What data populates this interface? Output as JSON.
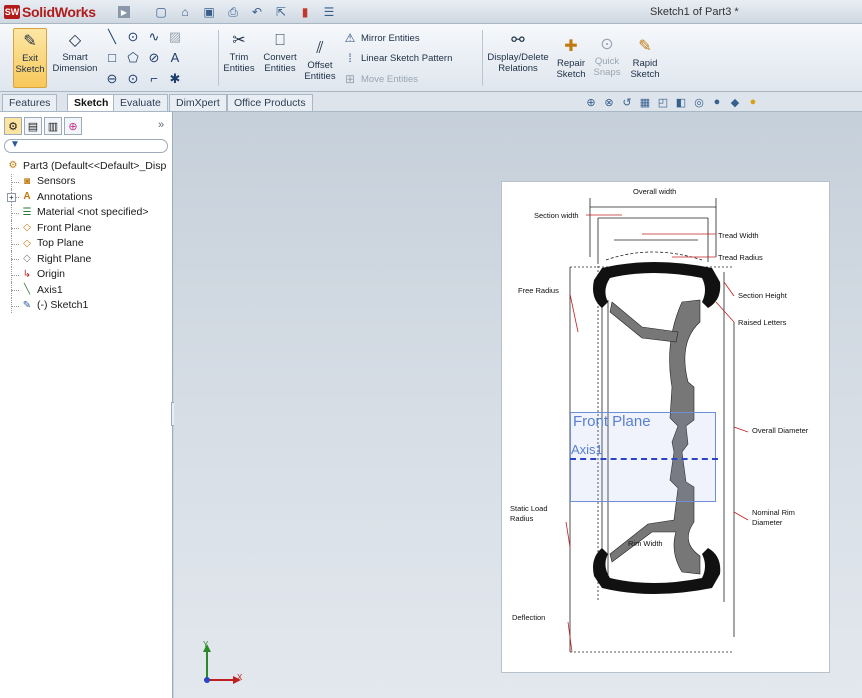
{
  "app": {
    "logo_mark": "SW",
    "name": "SolidWorks",
    "document_title": "Sketch1 of Part3 *"
  },
  "quick_access": [
    {
      "name": "new-icon",
      "glyph": "▢"
    },
    {
      "name": "open-icon",
      "glyph": "📂"
    },
    {
      "name": "save-icon",
      "glyph": "▣"
    },
    {
      "name": "print-icon",
      "glyph": "⎙"
    },
    {
      "name": "undo-icon",
      "glyph": "↶"
    },
    {
      "name": "select-icon",
      "glyph": "⇱"
    },
    {
      "name": "rebuild-icon",
      "glyph": "▮"
    },
    {
      "name": "options-icon",
      "glyph": "☰"
    }
  ],
  "ribbon": {
    "exit_sketch": {
      "line1": "Exit",
      "line2": "Sketch"
    },
    "smart_dimension": {
      "line1": "Smart",
      "line2": "Dimension"
    },
    "trim": {
      "line1": "Trim",
      "line2": "Entities"
    },
    "convert": {
      "line1": "Convert",
      "line2": "Entities"
    },
    "offset": {
      "line1": "Offset",
      "line2": "Entities"
    },
    "mirror": "Mirror Entities",
    "linear_pattern": "Linear Sketch Pattern",
    "move": "Move Entities",
    "display_delete": {
      "line1": "Display/Delete",
      "line2": "Relations"
    },
    "repair": {
      "line1": "Repair",
      "line2": "Sketch"
    },
    "quick_snaps": {
      "line1": "Quick",
      "line2": "Snaps"
    },
    "rapid": {
      "line1": "Rapid",
      "line2": "Sketch"
    }
  },
  "tabs": [
    "Features",
    "Sketch",
    "Evaluate",
    "DimXpert",
    "Office Products"
  ],
  "active_tab": "Sketch",
  "tree": {
    "root": "Part3  (Default<<Default>_Disp",
    "items": [
      {
        "label": "Sensors",
        "icon": "sensors-icon",
        "glyph": "◙"
      },
      {
        "label": "Annotations",
        "icon": "annotations-icon",
        "glyph": "A"
      },
      {
        "label": "Material <not specified>",
        "icon": "material-icon",
        "glyph": "☰"
      },
      {
        "label": "Front Plane",
        "icon": "plane-icon",
        "glyph": "◇"
      },
      {
        "label": "Top Plane",
        "icon": "plane-icon",
        "glyph": "◇"
      },
      {
        "label": "Right Plane",
        "icon": "plane-icon",
        "glyph": "◇"
      },
      {
        "label": "Origin",
        "icon": "origin-icon",
        "glyph": "↳"
      },
      {
        "label": "Axis1",
        "icon": "axis-icon",
        "glyph": "╲"
      },
      {
        "label": "(-) Sketch1",
        "icon": "sketch-icon",
        "glyph": "✎"
      }
    ]
  },
  "drawing": {
    "labels": [
      "Overall width",
      "Section width",
      "Tread Width",
      "Tread Radius",
      "Free Radius",
      "Section Height",
      "Raised Letters",
      "Overall Diameter",
      "Static Load",
      "Radius",
      "Nominal Rim",
      "Diameter",
      "Rim Width",
      "Deflection"
    ],
    "plane_label": "Front Plane",
    "axis_label": "Axis1"
  },
  "triad": {
    "y": "Y",
    "x": "X"
  },
  "colors": {
    "accent": "#b31b1b",
    "plane": "#5a7fd0",
    "axis": "#2a44c4"
  }
}
